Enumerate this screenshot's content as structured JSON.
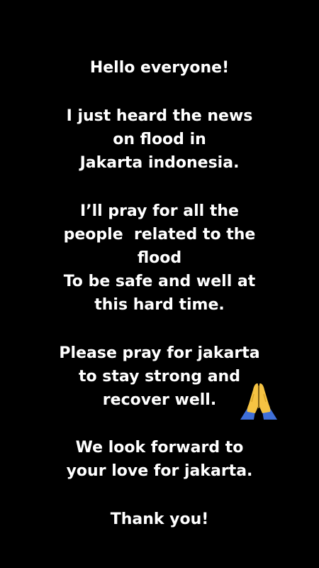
{
  "story": {
    "lines": [
      "Hello everyone!",
      "I just heard the news",
      "on flood in",
      "Jakarta indonesia.",
      "I’ll pray for all the",
      "people  related to the",
      "flood",
      "To be safe and well at",
      "this hard time.",
      "Please pray for jakarta",
      "to stay strong and",
      "recover well.",
      "We look forward to",
      "your love for jakarta.",
      "Thank you!"
    ],
    "sticker": "folded-hands-emoji"
  },
  "colors": {
    "background": "#000000",
    "text": "#ffffff",
    "sticker_skin": "#f5c343",
    "sticker_sleeve": "#3f6fd8"
  }
}
